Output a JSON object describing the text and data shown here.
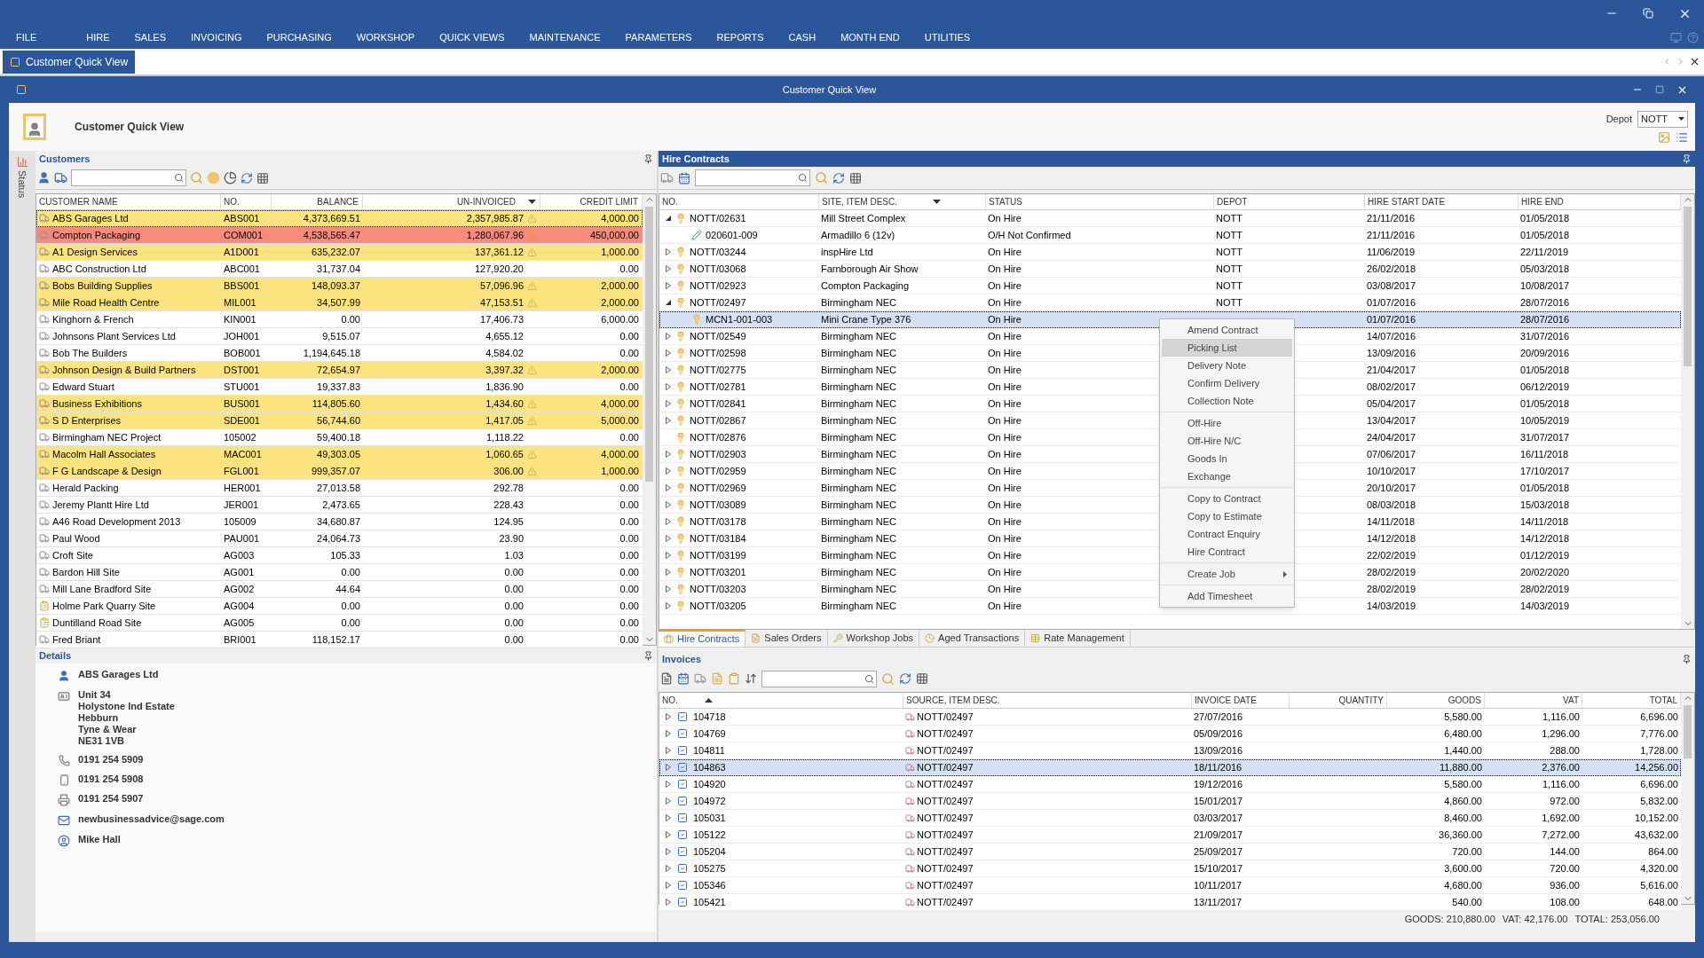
{
  "menu": [
    "FILE",
    "HIRE",
    "SALES",
    "INVOICING",
    "PURCHASING",
    "WORKSHOP",
    "QUICK VIEWS",
    "MAINTENANCE",
    "PARAMETERS",
    "REPORTS",
    "CASH",
    "MONTH END",
    "UTILITIES"
  ],
  "doc_tabs": [
    {
      "label": "Customer Quick View",
      "selected": true
    }
  ],
  "window": {
    "title": "Customer Quick View"
  },
  "header": {
    "title": "Customer Quick View",
    "depot_label": "Depot",
    "depot_value": "NOTT"
  },
  "status_tab": "Status",
  "customers": {
    "title": "Customers",
    "columns": [
      "CUSTOMER NAME",
      "NO.",
      "BALANCE",
      "UN-INVOICED",
      "CREDIT LIMIT"
    ],
    "rows": [
      {
        "kind": "hire",
        "name": "ABS Garages Ltd",
        "no": "ABS001",
        "balance": "4,373,669.51",
        "uninvoiced": "2,357,985.87",
        "credit": "4,000.00",
        "over_limit": true,
        "stopped": false,
        "selected": true
      },
      {
        "kind": "hire",
        "name": "Compton Packaging",
        "no": "COM001",
        "balance": "4,538,565.47",
        "uninvoiced": "1,280,067.96",
        "credit": "450,000.00",
        "over_limit": true,
        "stopped": true,
        "selected": false
      },
      {
        "kind": "hire",
        "name": "A1 Design Services",
        "no": "A1D001",
        "balance": "635,232.07",
        "uninvoiced": "137,361.12",
        "credit": "1,000.00",
        "over_limit": true,
        "stopped": false,
        "selected": false
      },
      {
        "kind": "hire",
        "name": "ABC Construction Ltd",
        "no": "ABC001",
        "balance": "31,737.04",
        "uninvoiced": "127,920.20",
        "credit": "0.00",
        "over_limit": false,
        "stopped": false,
        "selected": false
      },
      {
        "kind": "hire",
        "name": "Bobs Building Supplies",
        "no": "BBS001",
        "balance": "148,093.37",
        "uninvoiced": "57,096.96",
        "credit": "2,000.00",
        "over_limit": true,
        "stopped": false,
        "selected": false
      },
      {
        "kind": "hire",
        "name": "Mile Road Health Centre",
        "no": "MIL001",
        "balance": "34,507.99",
        "uninvoiced": "47,153.51",
        "credit": "2,000.00",
        "over_limit": true,
        "stopped": false,
        "selected": false
      },
      {
        "kind": "hire",
        "name": "Kinghorn & French",
        "no": "KIN001",
        "balance": "0.00",
        "uninvoiced": "17,406.73",
        "credit": "6,000.00",
        "over_limit": false,
        "stopped": false,
        "selected": false
      },
      {
        "kind": "hire",
        "name": "Johnsons Plant Services Ltd",
        "no": "JOH001",
        "balance": "9,515.07",
        "uninvoiced": "4,655.12",
        "credit": "0.00",
        "over_limit": false,
        "stopped": false,
        "selected": false
      },
      {
        "kind": "hire",
        "name": "Bob The Builders",
        "no": "BOB001",
        "balance": "1,194,645.18",
        "uninvoiced": "4,584.02",
        "credit": "0.00",
        "over_limit": false,
        "stopped": false,
        "selected": false
      },
      {
        "kind": "hire",
        "name": "Johnson Design & Build Partners",
        "no": "DST001",
        "balance": "72,654.97",
        "uninvoiced": "3,397.32",
        "credit": "2,000.00",
        "over_limit": true,
        "stopped": false,
        "selected": false
      },
      {
        "kind": "hire",
        "name": "Edward Stuart",
        "no": "STU001",
        "balance": "19,337.83",
        "uninvoiced": "1,836.90",
        "credit": "0.00",
        "over_limit": false,
        "stopped": false,
        "selected": false
      },
      {
        "kind": "hire",
        "name": "Business Exhibitions",
        "no": "BUS001",
        "balance": "114,805.60",
        "uninvoiced": "1,434.60",
        "credit": "4,000.00",
        "over_limit": true,
        "stopped": false,
        "selected": false
      },
      {
        "kind": "hire",
        "name": "S D Enterprises",
        "no": "SDE001",
        "balance": "56,744.60",
        "uninvoiced": "1,417.05",
        "credit": "5,000.00",
        "over_limit": true,
        "stopped": false,
        "selected": false
      },
      {
        "kind": "hire",
        "name": "Birmingham NEC Project",
        "no": "105002",
        "balance": "59,400.18",
        "uninvoiced": "1,118.22",
        "credit": "0.00",
        "over_limit": false,
        "stopped": false,
        "selected": false
      },
      {
        "kind": "hire",
        "name": "Macolm Hall Associates",
        "no": "MAC001",
        "balance": "49,303.05",
        "uninvoiced": "1,060.65",
        "credit": "4,000.00",
        "over_limit": true,
        "stopped": false,
        "selected": false
      },
      {
        "kind": "hire",
        "name": "F G Landscape & Design",
        "no": "FGL001",
        "balance": "999,357.07",
        "uninvoiced": "306.00",
        "credit": "1,000.00",
        "over_limit": true,
        "stopped": false,
        "selected": false
      },
      {
        "kind": "hire",
        "name": "Herald Packing",
        "no": "HER001",
        "balance": "27,013.58",
        "uninvoiced": "292.78",
        "credit": "0.00",
        "over_limit": false,
        "stopped": false,
        "selected": false
      },
      {
        "kind": "hire",
        "name": "Jeremy Plantt Hire Ltd",
        "no": "JER001",
        "balance": "2,473.65",
        "uninvoiced": "228.43",
        "credit": "0.00",
        "over_limit": false,
        "stopped": false,
        "selected": false
      },
      {
        "kind": "hire",
        "name": "A46 Road Development 2013",
        "no": "105009",
        "balance": "34,680.87",
        "uninvoiced": "124.95",
        "credit": "0.00",
        "over_limit": false,
        "stopped": false,
        "selected": false
      },
      {
        "kind": "hire",
        "name": "Paul Wood",
        "no": "PAU001",
        "balance": "24,064.73",
        "uninvoiced": "23.90",
        "credit": "0.00",
        "over_limit": false,
        "stopped": false,
        "selected": false
      },
      {
        "kind": "hire",
        "name": "Croft Site",
        "no": "AG003",
        "balance": "105.33",
        "uninvoiced": "1.03",
        "credit": "0.00",
        "over_limit": false,
        "stopped": false,
        "selected": false
      },
      {
        "kind": "hire",
        "name": "Bardon Hill Site",
        "no": "AG001",
        "balance": "0.00",
        "uninvoiced": "0.00",
        "credit": "0.00",
        "over_limit": false,
        "stopped": false,
        "selected": false
      },
      {
        "kind": "hire",
        "name": "Mill Lane Bradford Site",
        "no": "AG002",
        "balance": "44.64",
        "uninvoiced": "0.00",
        "credit": "0.00",
        "over_limit": false,
        "stopped": false,
        "selected": false
      },
      {
        "kind": "site",
        "name": "Holme Park Quarry Site",
        "no": "AG004",
        "balance": "0.00",
        "uninvoiced": "0.00",
        "credit": "0.00",
        "over_limit": false,
        "stopped": false,
        "selected": false
      },
      {
        "kind": "site",
        "name": "Duntilland Road Site",
        "no": "AG005",
        "balance": "0.00",
        "uninvoiced": "0.00",
        "credit": "0.00",
        "over_limit": false,
        "stopped": false,
        "selected": false
      },
      {
        "kind": "hire",
        "name": "Fred Briant",
        "no": "BRI001",
        "balance": "118,152.17",
        "uninvoiced": "0.00",
        "credit": "0.00",
        "over_limit": false,
        "stopped": false,
        "selected": false
      }
    ]
  },
  "details": {
    "title": "Details",
    "items": [
      {
        "kind": "person",
        "lines": [
          "ABS Garages Ltd"
        ]
      },
      {
        "kind": "address",
        "lines": [
          "Unit 34",
          "Holystone Ind Estate",
          "Hebburn",
          "Tyne & Wear",
          "NE31 1VB"
        ]
      },
      {
        "kind": "phone",
        "lines": [
          "0191 254 5909"
        ]
      },
      {
        "kind": "mobile",
        "lines": [
          "0191 254 5908"
        ]
      },
      {
        "kind": "fax",
        "lines": [
          "0191 254 5907"
        ]
      },
      {
        "kind": "email",
        "lines": [
          "newbusinessadvice@sage.com"
        ]
      },
      {
        "kind": "contact",
        "lines": [
          "Mike Hall"
        ]
      }
    ]
  },
  "hire_contracts": {
    "title": "Hire Contracts",
    "columns": [
      "NO.",
      "SITE, ITEM DESC.",
      "STATUS",
      "DEPOT",
      "HIRE START DATE",
      "HIRE END"
    ],
    "rows": [
      {
        "kind": "contract",
        "no": "NOTT/02631",
        "site": "Mill Street Complex",
        "status": "On Hire",
        "depot": "NOTT",
        "start": "21/11/2016",
        "end": "01/05/2018",
        "expandable": true,
        "expanded": true,
        "selected": false,
        "children": [
          {
            "kind": "item_pending",
            "no": "020601-009",
            "site": "Armadillo 6 (12v)",
            "status": "O/H Not Confirmed",
            "depot": "NOTT",
            "start": "21/11/2016",
            "end": "01/05/2018",
            "selected": false
          }
        ]
      },
      {
        "kind": "contract",
        "no": "NOTT/03244",
        "site": "inspHire Ltd",
        "status": "On Hire",
        "depot": "NOTT",
        "start": "11/06/2019",
        "end": "22/11/2019",
        "expandable": true,
        "expanded": false,
        "selected": false
      },
      {
        "kind": "contract",
        "no": "NOTT/03068",
        "site": "Farnborough Air Show",
        "status": "On Hire",
        "depot": "NOTT",
        "start": "26/02/2018",
        "end": "05/03/2018",
        "expandable": true,
        "expanded": false,
        "selected": false
      },
      {
        "kind": "contract",
        "no": "NOTT/02923",
        "site": "Compton Packaging",
        "status": "On Hire",
        "depot": "NOTT",
        "start": "03/08/2017",
        "end": "10/08/2017",
        "expandable": true,
        "expanded": false,
        "selected": false
      },
      {
        "kind": "contract",
        "no": "NOTT/02497",
        "site": "Birmingham NEC",
        "status": "On Hire",
        "depot": "NOTT",
        "start": "01/07/2016",
        "end": "28/07/2016",
        "expandable": true,
        "expanded": true,
        "selected": false,
        "children": [
          {
            "kind": "item",
            "no": "MCN1-001-003",
            "site": "Mini Crane Type 376",
            "status": "On Hire",
            "start": "01/07/2016",
            "end": "28/07/2016",
            "selected": true
          }
        ]
      },
      {
        "kind": "contract",
        "no": "NOTT/02549",
        "site": "Birmingham NEC",
        "status": "On Hire",
        "start": "14/07/2016",
        "end": "31/07/2016",
        "expandable": true,
        "expanded": false,
        "selected": false
      },
      {
        "kind": "contract",
        "no": "NOTT/02598",
        "site": "Birmingham NEC",
        "status": "On Hire",
        "start": "13/09/2016",
        "end": "20/09/2016",
        "expandable": true,
        "expanded": false,
        "selected": false
      },
      {
        "kind": "contract",
        "no": "NOTT/02775",
        "site": "Birmingham NEC",
        "status": "On Hire",
        "start": "21/04/2017",
        "end": "01/05/2018",
        "expandable": true,
        "expanded": false,
        "selected": false
      },
      {
        "kind": "contract",
        "no": "NOTT/02781",
        "site": "Birmingham NEC",
        "status": "On Hire",
        "start": "08/02/2017",
        "end": "06/12/2019",
        "expandable": true,
        "expanded": false,
        "selected": false
      },
      {
        "kind": "contract",
        "no": "NOTT/02841",
        "site": "Birmingham NEC",
        "status": "On Hire",
        "start": "05/04/2017",
        "end": "01/05/2018",
        "expandable": true,
        "expanded": false,
        "selected": false
      },
      {
        "kind": "contract",
        "no": "NOTT/02867",
        "site": "Birmingham NEC",
        "status": "On Hire",
        "start": "13/04/2017",
        "end": "10/05/2019",
        "expandable": true,
        "expanded": false,
        "selected": false
      },
      {
        "kind": "contract",
        "no": "NOTT/02876",
        "site": "Birmingham NEC",
        "status": "On Hire",
        "start": "24/04/2017",
        "end": "31/07/2017",
        "expandable": false,
        "expanded": false,
        "selected": false
      },
      {
        "kind": "contract",
        "no": "NOTT/02903",
        "site": "Birmingham NEC",
        "status": "On Hire",
        "start": "07/06/2017",
        "end": "16/11/2018",
        "expandable": true,
        "expanded": false,
        "selected": false
      },
      {
        "kind": "contract",
        "no": "NOTT/02959",
        "site": "Birmingham NEC",
        "status": "On Hire",
        "start": "10/10/2017",
        "end": "17/10/2017",
        "expandable": true,
        "expanded": false,
        "selected": false
      },
      {
        "kind": "contract",
        "no": "NOTT/02969",
        "site": "Birmingham NEC",
        "status": "On Hire",
        "start": "20/10/2017",
        "end": "01/05/2018",
        "expandable": true,
        "expanded": false,
        "selected": false
      },
      {
        "kind": "contract",
        "no": "NOTT/03089",
        "site": "Birmingham NEC",
        "status": "On Hire",
        "start": "08/03/2018",
        "end": "15/03/2018",
        "expandable": true,
        "expanded": false,
        "selected": false
      },
      {
        "kind": "contract",
        "no": "NOTT/03178",
        "site": "Birmingham NEC",
        "status": "On Hire",
        "start": "14/11/2018",
        "end": "14/11/2018",
        "expandable": true,
        "expanded": false,
        "selected": false
      },
      {
        "kind": "contract",
        "no": "NOTT/03184",
        "site": "Birmingham NEC",
        "status": "On Hire",
        "start": "14/12/2018",
        "end": "14/12/2018",
        "expandable": true,
        "expanded": false,
        "selected": false
      },
      {
        "kind": "contract",
        "no": "NOTT/03199",
        "site": "Birmingham NEC",
        "status": "On Hire",
        "start": "22/02/2019",
        "end": "01/12/2019",
        "expandable": true,
        "expanded": false,
        "selected": false
      },
      {
        "kind": "contract",
        "no": "NOTT/03201",
        "site": "Birmingham NEC",
        "status": "On Hire",
        "start": "28/02/2019",
        "end": "20/02/2020",
        "expandable": true,
        "expanded": false,
        "selected": false
      },
      {
        "kind": "contract",
        "no": "NOTT/03203",
        "site": "Birmingham NEC",
        "status": "On Hire",
        "start": "28/02/2019",
        "end": "28/02/2019",
        "expandable": true,
        "expanded": false,
        "selected": false
      },
      {
        "kind": "contract",
        "no": "NOTT/03205",
        "site": "Birmingham NEC",
        "status": "On Hire",
        "start": "14/03/2019",
        "end": "14/03/2019",
        "expandable": true,
        "expanded": false,
        "selected": false
      }
    ],
    "context_menu": {
      "groups": [
        {
          "items": [
            {
              "label": "Amend Contract",
              "selected": false,
              "submenu": false
            },
            {
              "label": "Picking List",
              "selected": true,
              "submenu": false
            },
            {
              "label": "Delivery Note",
              "selected": false,
              "submenu": false
            },
            {
              "label": "Confirm Delivery",
              "selected": false,
              "submenu": false
            },
            {
              "label": "Collection Note",
              "selected": false,
              "submenu": false
            }
          ]
        },
        {
          "items": [
            {
              "label": "Off-Hire",
              "selected": false,
              "submenu": false
            },
            {
              "label": "Off-Hire N/C",
              "selected": false,
              "submenu": false
            },
            {
              "label": "Goods In",
              "selected": false,
              "submenu": false
            },
            {
              "label": "Exchange",
              "selected": false,
              "submenu": false
            }
          ]
        },
        {
          "items": [
            {
              "label": "Copy to Contract",
              "selected": false,
              "submenu": false
            },
            {
              "label": "Copy to Estimate",
              "selected": false,
              "submenu": false
            },
            {
              "label": "Contract Enquiry",
              "selected": false,
              "submenu": false
            },
            {
              "label": "Hire Contract",
              "selected": false,
              "submenu": false
            }
          ]
        },
        {
          "items": [
            {
              "label": "Create Job",
              "selected": false,
              "submenu": true
            }
          ]
        },
        {
          "items": [
            {
              "label": "Add Timesheet",
              "selected": false,
              "submenu": false
            }
          ]
        }
      ]
    },
    "tabs": [
      {
        "label": "Hire Contracts",
        "selected": true
      },
      {
        "label": "Sales Orders",
        "selected": false
      },
      {
        "label": "Workshop Jobs",
        "selected": false
      },
      {
        "label": "Aged Transactions",
        "selected": false
      },
      {
        "label": "Rate Management",
        "selected": false
      }
    ]
  },
  "invoices": {
    "title": "Invoices",
    "columns": [
      "NO.",
      "SOURCE, ITEM DESC.",
      "INVOICE DATE",
      "QUANTITY",
      "GOODS",
      "VAT",
      "TOTAL"
    ],
    "rows": [
      {
        "no": "104718",
        "source": "NOTT/02497",
        "date": "27/07/2016",
        "goods": "5,580.00",
        "vat": "1,116.00",
        "total": "6,696.00",
        "selected": false
      },
      {
        "no": "104769",
        "source": "NOTT/02497",
        "date": "05/09/2016",
        "goods": "6,480.00",
        "vat": "1,296.00",
        "total": "7,776.00",
        "selected": false
      },
      {
        "no": "104811",
        "source": "NOTT/02497",
        "date": "13/09/2016",
        "goods": "1,440.00",
        "vat": "288.00",
        "total": "1,728.00",
        "selected": false
      },
      {
        "no": "104863",
        "source": "NOTT/02497",
        "date": "18/11/2016",
        "goods": "11,880.00",
        "vat": "2,376.00",
        "total": "14,256.00",
        "selected": true
      },
      {
        "no": "104920",
        "source": "NOTT/02497",
        "date": "19/12/2016",
        "goods": "5,580.00",
        "vat": "1,116.00",
        "total": "6,696.00",
        "selected": false
      },
      {
        "no": "104972",
        "source": "NOTT/02497",
        "date": "15/01/2017",
        "goods": "4,860.00",
        "vat": "972.00",
        "total": "5,832.00",
        "selected": false
      },
      {
        "no": "105031",
        "source": "NOTT/02497",
        "date": "03/03/2017",
        "goods": "8,460.00",
        "vat": "1,692.00",
        "total": "10,152.00",
        "selected": false
      },
      {
        "no": "105122",
        "source": "NOTT/02497",
        "date": "21/09/2017",
        "goods": "36,360.00",
        "vat": "7,272.00",
        "total": "43,632.00",
        "selected": false
      },
      {
        "no": "105204",
        "source": "NOTT/02497",
        "date": "25/09/2017",
        "goods": "720.00",
        "vat": "144.00",
        "total": "864.00",
        "selected": false
      },
      {
        "no": "105275",
        "source": "NOTT/02497",
        "date": "15/10/2017",
        "goods": "3,600.00",
        "vat": "720.00",
        "total": "4,320.00",
        "selected": false
      },
      {
        "no": "105346",
        "source": "NOTT/02497",
        "date": "10/11/2017",
        "goods": "4,680.00",
        "vat": "936.00",
        "total": "5,616.00",
        "selected": false
      },
      {
        "no": "105421",
        "source": "NOTT/02497",
        "date": "13/11/2017",
        "goods": "540.00",
        "vat": "108.00",
        "total": "648.00",
        "selected": false
      }
    ],
    "totals": [
      "GOODS: 210,880.00",
      "VAT: 42,176.00",
      "TOTAL: 253,056.00"
    ]
  }
}
